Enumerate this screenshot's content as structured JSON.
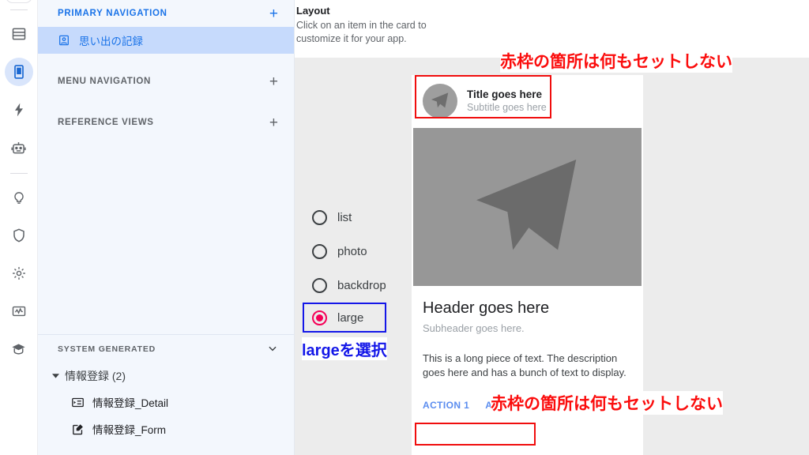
{
  "rail": {
    "items": [
      {
        "name": "data-icon",
        "selected": false
      },
      {
        "name": "mobile-app-icon",
        "selected": true
      },
      {
        "name": "automation-icon",
        "selected": false
      },
      {
        "name": "bot-icon",
        "selected": false
      },
      {
        "name": "lightbulb-icon",
        "selected": false
      },
      {
        "name": "shield-icon",
        "selected": false
      },
      {
        "name": "settings-icon",
        "selected": false
      },
      {
        "name": "monitor-icon",
        "selected": false
      },
      {
        "name": "learn-icon",
        "selected": false
      }
    ]
  },
  "nav": {
    "primary": {
      "label": "PRIMARY NAVIGATION",
      "add": "+"
    },
    "primary_items": [
      {
        "label": "思い出の記録",
        "selected": true
      }
    ],
    "menu": {
      "label": "MENU NAVIGATION",
      "add": "+"
    },
    "reference": {
      "label": "REFERENCE VIEWS",
      "add": "+"
    },
    "system_generated": {
      "label": "SYSTEM GENERATED",
      "chevron": "❯"
    },
    "tree_group": {
      "label": "情報登録 (2)",
      "triangle": "▼"
    },
    "tree_items": [
      {
        "label": "情報登録_Detail",
        "icon": "detail-view-icon"
      },
      {
        "label": "情報登録_Form",
        "icon": "form-view-icon"
      }
    ]
  },
  "stage": {
    "title": "Layout",
    "subtitle": "Click on an item in the card to customize it for your app.",
    "options": [
      {
        "label": "list",
        "selected": false
      },
      {
        "label": "photo",
        "selected": false
      },
      {
        "label": "backdrop",
        "selected": false
      },
      {
        "label": "large",
        "selected": true
      }
    ]
  },
  "card": {
    "title": "Title goes here",
    "subtitle": "Subtitle goes here",
    "header": "Header goes here",
    "subheader": "Subheader goes here.",
    "paragraph": "This is a long piece of text. The description goes here and has a bunch of text to display.",
    "action_1": "ACTION 1",
    "action_2": "ACTION 2"
  },
  "annotations": {
    "red_top": "赤枠の箇所は何もセットしない",
    "red_bottom": "赤枠の箇所は何もセットしない",
    "blue": "largeを選択"
  },
  "colors": {
    "accent_blue": "#1a73e8",
    "selected_row": "#c6dafc",
    "annotation_red": "#fb0d0d",
    "annotation_blue": "#1417e8",
    "radio_selected": "#f50057",
    "action_link": "#5b8def"
  }
}
